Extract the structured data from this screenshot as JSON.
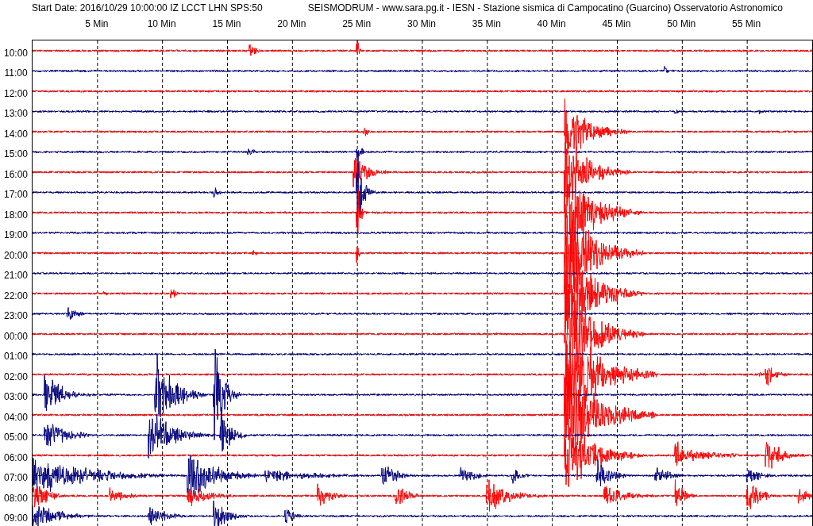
{
  "header": {
    "start_info": "Start Date: 2016/10/29 10:00:00 IZ LCCT LHN SPS:50",
    "station_title": "SEISMODRUM - www.sara.pg.it - IESN - Stazione sismica di Campocatino (Guarcino) Osservatorio Astronomico"
  },
  "minute_labels": [
    "5 Min",
    "10 Min",
    "15 Min",
    "20 Min",
    "25 Min",
    "30 Min",
    "35 Min",
    "40 Min",
    "45 Min",
    "50 Min",
    "55 Min"
  ],
  "traces": [
    {
      "time": "10:00",
      "color": "#ff0000"
    },
    {
      "time": "11:00",
      "color": "#000080"
    },
    {
      "time": "12:00",
      "color": "#ff0000"
    },
    {
      "time": "13:00",
      "color": "#000080"
    },
    {
      "time": "14:00",
      "color": "#ff0000"
    },
    {
      "time": "15:00",
      "color": "#000080"
    },
    {
      "time": "16:00",
      "color": "#ff0000"
    },
    {
      "time": "17:00",
      "color": "#000080"
    },
    {
      "time": "18:00",
      "color": "#ff0000"
    },
    {
      "time": "19:00",
      "color": "#000080"
    },
    {
      "time": "20:00",
      "color": "#ff0000"
    },
    {
      "time": "21:00",
      "color": "#000080"
    },
    {
      "time": "22:00",
      "color": "#ff0000"
    },
    {
      "time": "23:00",
      "color": "#000080"
    },
    {
      "time": "00:00",
      "color": "#ff0000"
    },
    {
      "time": "01:00",
      "color": "#000080"
    },
    {
      "time": "02:00",
      "color": "#ff0000"
    },
    {
      "time": "03:00",
      "color": "#000080"
    },
    {
      "time": "04:00",
      "color": "#ff0000"
    },
    {
      "time": "05:00",
      "color": "#000080"
    },
    {
      "time": "06:00",
      "color": "#ff0000"
    },
    {
      "time": "07:00",
      "color": "#000080"
    },
    {
      "time": "08:00",
      "color": "#ff0000"
    },
    {
      "time": "09:00",
      "color": "#000080"
    }
  ]
}
